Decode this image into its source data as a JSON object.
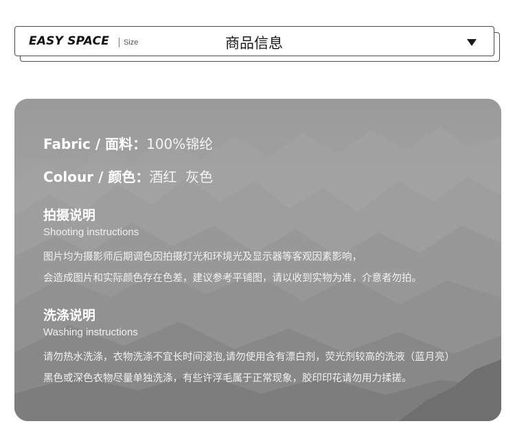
{
  "header": {
    "brand": "EASY SPACE",
    "size_label": "Size",
    "title": "商品信息",
    "dropdown_icon": "triangle-down-icon"
  },
  "info": {
    "fabric": {
      "label": "Fabric / 面料：",
      "value": "100%锦纶"
    },
    "colour": {
      "label": "Colour / 颜色：",
      "value": "酒红  灰色"
    },
    "shooting": {
      "title": "拍摄说明",
      "subtitle": "Shooting instructions",
      "lines": [
        "图片均为摄影师后期调色因拍摄灯光和环境光及显示器等客观因素影响，",
        "会造成图片和实际颜色存在色差，建议参考平铺图，请以收到实物为准，介意者勿拍。"
      ]
    },
    "washing": {
      "title": "洗涤说明",
      "subtitle": "Washing instructions",
      "lines": [
        "请勿热水洗涤，衣物洗涤不宜长时间浸泡,请勿使用含有漂白剂，荧光剂较高的洗液（蓝月亮）",
        "黑色或深色衣物尽量单独洗涤，有些许浮毛属于正常现象，胶印印花请勿用力揉搓。"
      ]
    }
  },
  "colors": {
    "card_background": "#8e8e8e",
    "text": "#ffffff",
    "border": "#4a4a4a"
  }
}
